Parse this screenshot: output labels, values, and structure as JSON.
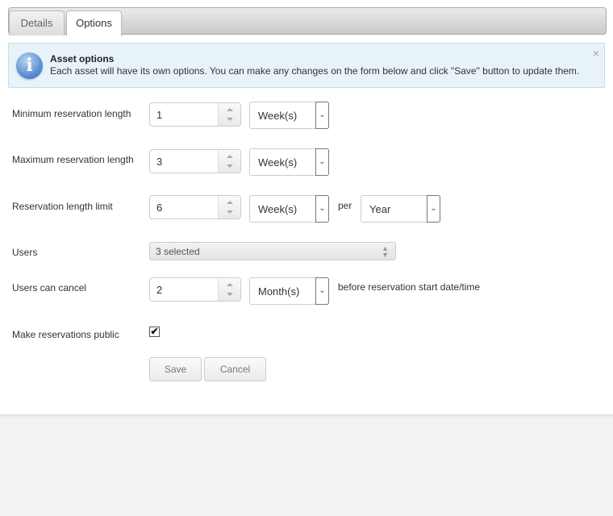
{
  "tabs": [
    {
      "label": "Details",
      "active": false
    },
    {
      "label": "Options",
      "active": true
    }
  ],
  "info": {
    "icon": "info-icon",
    "title": "Asset options",
    "text": "Each asset will have its own options. You can make any changes on the form below and click \"Save\" button to update them.",
    "close": "×"
  },
  "form": {
    "min_length": {
      "label": "Minimum reservation length",
      "value": "1",
      "unit": "Week(s)"
    },
    "max_length": {
      "label": "Maximum reservation length",
      "value": "3",
      "unit": "Week(s)"
    },
    "length_limit": {
      "label": "Reservation length limit",
      "value": "6",
      "unit": "Week(s)",
      "per_label": "per",
      "period": "Year"
    },
    "users": {
      "label": "Users",
      "value": "3 selected"
    },
    "users_cancel": {
      "label": "Users can cancel",
      "value": "2",
      "unit": "Month(s)",
      "suffix": "before reservation start date/time"
    },
    "public": {
      "label": "Make reservations public",
      "checked": true,
      "check_glyph": "✔"
    }
  },
  "buttons": {
    "save": "Save",
    "cancel": "Cancel"
  },
  "icons": {
    "select_arrow": "⌄",
    "multiselect_caret": "▲▼"
  }
}
